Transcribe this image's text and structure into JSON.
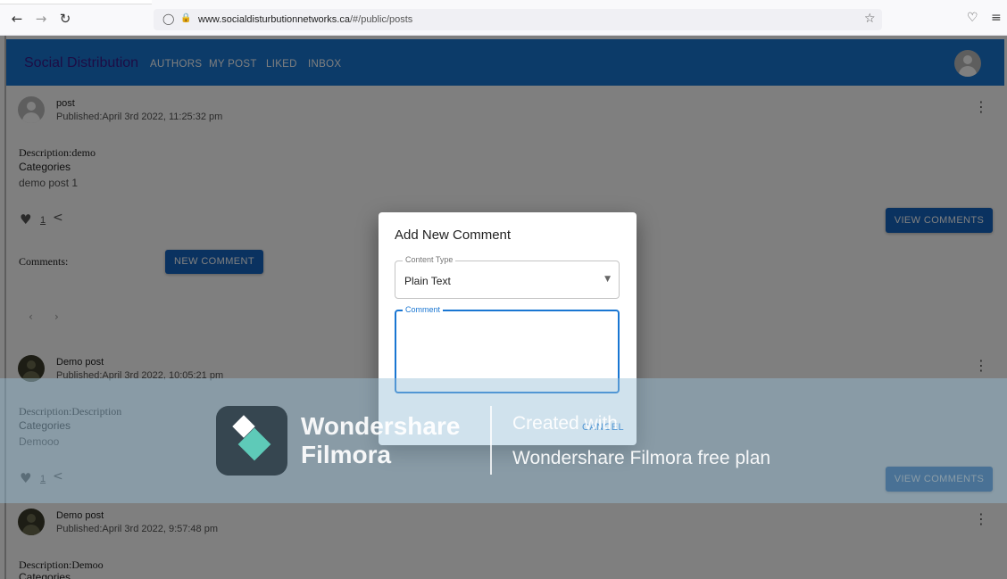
{
  "browser": {
    "url_host": "www.socialdisturbutionnetworks.ca",
    "url_path": "/#/public/posts",
    "back_icon": "←",
    "forward_icon": "→",
    "reload_icon": "↻",
    "shield_icon": "◯",
    "lock_icon": "🔒",
    "star_icon": "☆",
    "pocket_icon": "♡",
    "menu_icon": "≡"
  },
  "appbar": {
    "brand": "Social Distribution",
    "nav": [
      "AUTHORS",
      "MY POST",
      "LIKED",
      "INBOX"
    ]
  },
  "posts": [
    {
      "title": "post",
      "published": "Published:April 3rd 2022, 11:25:32 pm",
      "description": "Description:demo",
      "categories": "Categories",
      "content": "demo post 1",
      "likes": "1",
      "view_comments": "VIEW COMMENTS",
      "comments_label": "Comments:",
      "new_comment": "NEW COMMENT"
    },
    {
      "title": "Demo post",
      "published": "Published:April 3rd 2022, 10:05:21 pm",
      "description": "Description:Description",
      "categories": "Categories",
      "content": "Demooo",
      "likes": "1",
      "view_comments": "VIEW COMMENTS"
    },
    {
      "title": "Demo post",
      "published": "Published:April 3rd 2022, 9:57:48 pm",
      "description": "Description:Demoo",
      "categories": "Categories"
    }
  ],
  "icons": {
    "kebab": "⋮",
    "heart": "♥",
    "share": "<",
    "prev": "‹",
    "next": "›",
    "dropdown": "▼"
  },
  "dialog": {
    "title": "Add New Comment",
    "content_type_label": "Content Type",
    "content_type_value": "Plain Text",
    "comment_label": "Comment",
    "cancel": "CANCEL"
  },
  "watermark": {
    "brand_line1": "Wondershare",
    "brand_line2": "Filmora",
    "created_with": "Created with",
    "plan": "Wondershare Filmora free plan"
  },
  "colors": {
    "appbar": "#1976d2",
    "button": "#1565c0"
  }
}
